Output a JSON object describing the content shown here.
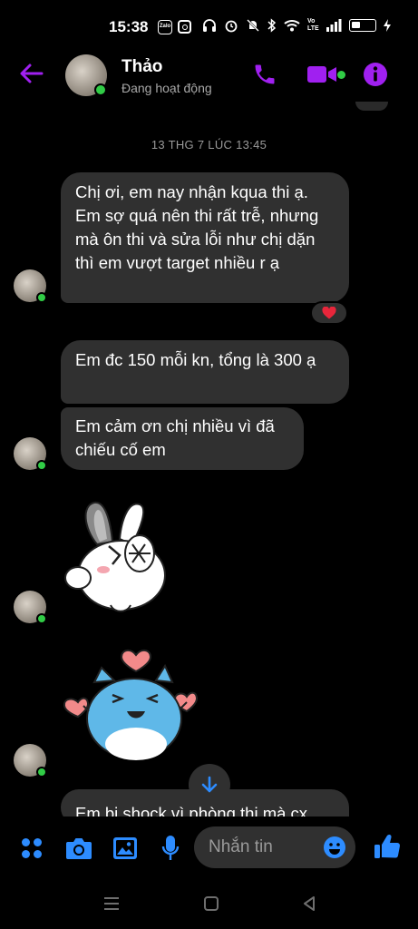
{
  "status_bar": {
    "time": "15:38",
    "app_badge": "Zalo",
    "icons": [
      "zalo-icon",
      "instagram-icon",
      "headphones-icon",
      "alarm-icon",
      "mute-icon",
      "bluetooth-icon",
      "wifi-icon",
      "volte-icon",
      "signal-icon",
      "battery-icon",
      "charging-icon"
    ],
    "volte": "Vo LTE"
  },
  "header": {
    "contact_name": "Thảo",
    "contact_status": "Đang hoạt động",
    "accent_color": "#a020f0",
    "online_color": "#31cc46"
  },
  "conversation": {
    "timestamp": "13 THG 7 LÚC 13:45",
    "messages": [
      {
        "text": "Chị ơi, em nay nhận kqua thi ạ. Em sợ quá nên thi rất trễ, nhưng mà ôn thi và sửa lỗi như chị dặn thì em vượt target nhiều r ạ",
        "reaction": "heart"
      },
      {
        "text": "Em đc 150 mỗi kn, tổng là 300 ạ"
      },
      {
        "text": "Em cảm ơn chị nhiều vì đã chiếu cố em"
      },
      {
        "sticker": "bunny-hiding-face-sticker"
      },
      {
        "sticker": "blue-cat-hearts-sticker"
      },
      {
        "text": "Em bị shock vì phòng thi mà cx"
      }
    ]
  },
  "composer": {
    "placeholder": "Nhắn tin",
    "icon_color": "#2d8cff"
  }
}
